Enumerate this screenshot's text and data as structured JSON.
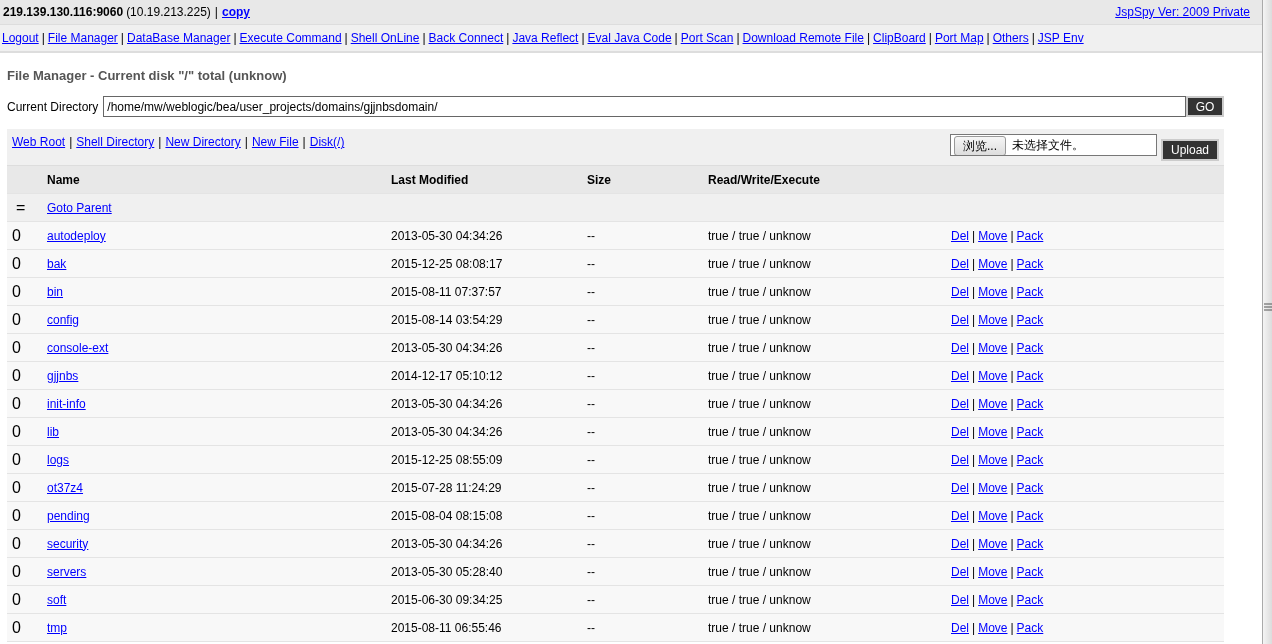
{
  "separator": "|",
  "header": {
    "host": "219.139.130.116:9060",
    "ip": "(10.19.213.225)",
    "copy_link": "copy",
    "version_link": "JspSpy Ver: 2009 Private"
  },
  "nav": [
    "Logout",
    "File Manager",
    "DataBase Manager",
    "Execute Command",
    "Shell OnLine",
    "Back Connect",
    "Java Reflect",
    "Eval Java Code",
    "Port Scan",
    "Download Remote File",
    "ClipBoard",
    "Port Map",
    "Others",
    "JSP Env"
  ],
  "title": "File Manager - Current disk \"/\" total (unknow)",
  "directory": {
    "label": "Current Directory",
    "value": "/home/mw/weblogic/bea/user_projects/domains/gjjnbsdomain/",
    "button": "GO"
  },
  "toolbar": [
    "Web Root",
    "Shell Directory",
    "New Directory",
    "New File",
    "Disk(/)"
  ],
  "upload": {
    "browse_button": "浏览...",
    "file_status": "未选择文件。",
    "button": "Upload"
  },
  "table": {
    "columns": [
      "Name",
      "Last Modified",
      "Size",
      "Read/Write/Execute"
    ],
    "parent": {
      "icon": "=",
      "link": "Goto Parent"
    },
    "rows": [
      {
        "mark": "0",
        "name": "autodeploy",
        "modified": "2013-05-30 04:34:26",
        "size": "--",
        "rwx": "true / true / unknow",
        "actions": [
          "Del",
          "Move",
          "Pack"
        ]
      },
      {
        "mark": "0",
        "name": "bak",
        "modified": "2015-12-25 08:08:17",
        "size": "--",
        "rwx": "true / true / unknow",
        "actions": [
          "Del",
          "Move",
          "Pack"
        ]
      },
      {
        "mark": "0",
        "name": "bin",
        "modified": "2015-08-11 07:37:57",
        "size": "--",
        "rwx": "true / true / unknow",
        "actions": [
          "Del",
          "Move",
          "Pack"
        ]
      },
      {
        "mark": "0",
        "name": "config",
        "modified": "2015-08-14 03:54:29",
        "size": "--",
        "rwx": "true / true / unknow",
        "actions": [
          "Del",
          "Move",
          "Pack"
        ]
      },
      {
        "mark": "0",
        "name": "console-ext",
        "modified": "2013-05-30 04:34:26",
        "size": "--",
        "rwx": "true / true / unknow",
        "actions": [
          "Del",
          "Move",
          "Pack"
        ]
      },
      {
        "mark": "0",
        "name": "gjjnbs",
        "modified": "2014-12-17 05:10:12",
        "size": "--",
        "rwx": "true / true / unknow",
        "actions": [
          "Del",
          "Move",
          "Pack"
        ]
      },
      {
        "mark": "0",
        "name": "init-info",
        "modified": "2013-05-30 04:34:26",
        "size": "--",
        "rwx": "true / true / unknow",
        "actions": [
          "Del",
          "Move",
          "Pack"
        ]
      },
      {
        "mark": "0",
        "name": "lib",
        "modified": "2013-05-30 04:34:26",
        "size": "--",
        "rwx": "true / true / unknow",
        "actions": [
          "Del",
          "Move",
          "Pack"
        ]
      },
      {
        "mark": "0",
        "name": "logs",
        "modified": "2015-12-25 08:55:09",
        "size": "--",
        "rwx": "true / true / unknow",
        "actions": [
          "Del",
          "Move",
          "Pack"
        ]
      },
      {
        "mark": "0",
        "name": "ot37z4",
        "modified": "2015-07-28 11:24:29",
        "size": "--",
        "rwx": "true / true / unknow",
        "actions": [
          "Del",
          "Move",
          "Pack"
        ]
      },
      {
        "mark": "0",
        "name": "pending",
        "modified": "2015-08-04 08:15:08",
        "size": "--",
        "rwx": "true / true / unknow",
        "actions": [
          "Del",
          "Move",
          "Pack"
        ]
      },
      {
        "mark": "0",
        "name": "security",
        "modified": "2013-05-30 04:34:26",
        "size": "--",
        "rwx": "true / true / unknow",
        "actions": [
          "Del",
          "Move",
          "Pack"
        ]
      },
      {
        "mark": "0",
        "name": "servers",
        "modified": "2013-05-30 05:28:40",
        "size": "--",
        "rwx": "true / true / unknow",
        "actions": [
          "Del",
          "Move",
          "Pack"
        ]
      },
      {
        "mark": "0",
        "name": "soft",
        "modified": "2015-06-30 09:34:25",
        "size": "--",
        "rwx": "true / true / unknow",
        "actions": [
          "Del",
          "Move",
          "Pack"
        ]
      },
      {
        "mark": "0",
        "name": "tmp",
        "modified": "2015-08-11 06:55:46",
        "size": "--",
        "rwx": "true / true / unknow",
        "actions": [
          "Del",
          "Move",
          "Pack"
        ]
      }
    ]
  }
}
